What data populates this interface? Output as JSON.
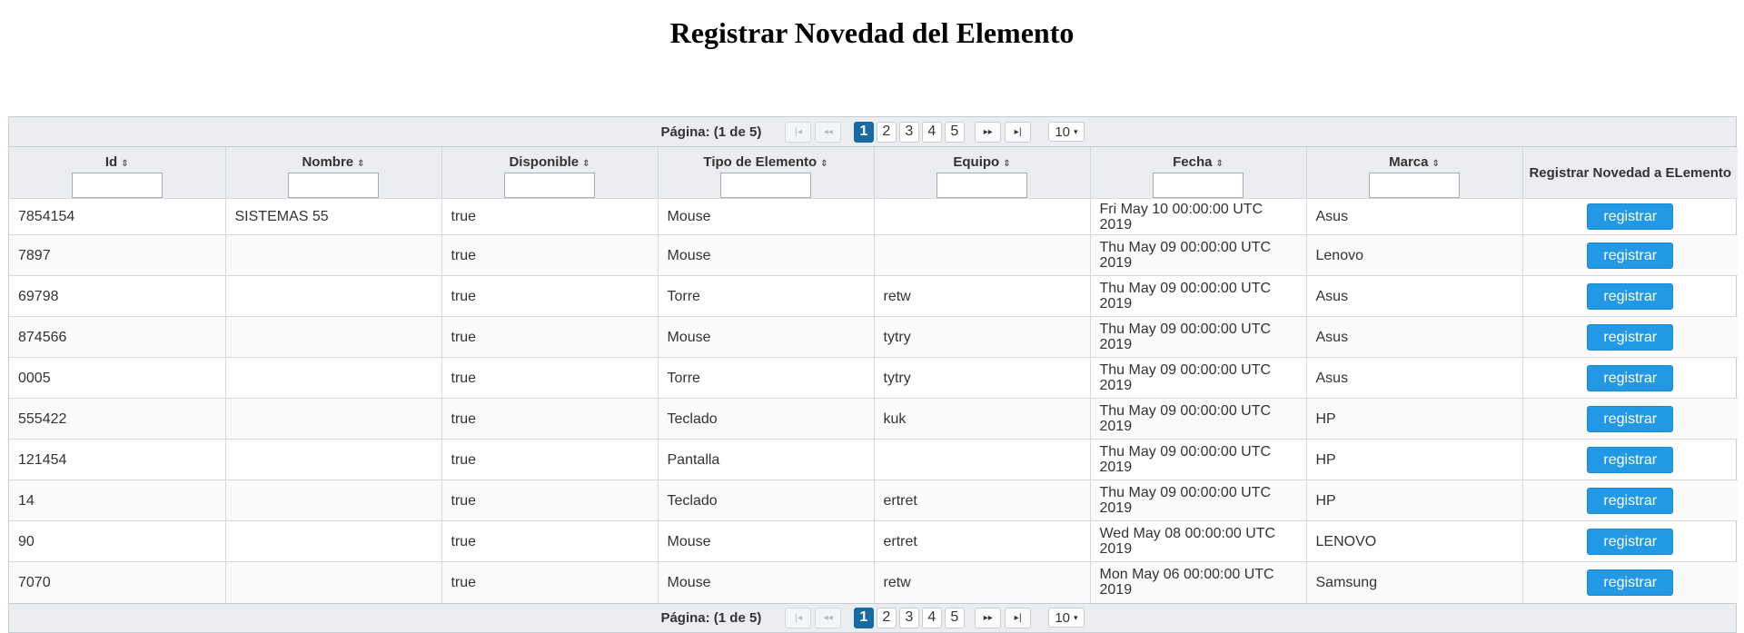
{
  "page": {
    "title": "Registrar Novedad del Elemento"
  },
  "paginator": {
    "current_label": "Página: (1 de 5)",
    "first_icon": "first-page-icon",
    "prev_icon": "prev-page-icon",
    "next_icon": "next-page-icon",
    "last_icon": "last-page-icon",
    "first_glyph": "|◂",
    "prev_glyph": "◂◂",
    "next_glyph": "▸▸",
    "last_glyph": "▸|",
    "pages": [
      "1",
      "2",
      "3",
      "4",
      "5"
    ],
    "active_page": "1",
    "rows_per_page": "10",
    "rows_caret": "▾"
  },
  "table": {
    "sort_glyph": "⇕",
    "columns": [
      {
        "label": "Id",
        "sortable": true,
        "filter": true
      },
      {
        "label": "Nombre",
        "sortable": true,
        "filter": true
      },
      {
        "label": "Disponible",
        "sortable": true,
        "filter": true
      },
      {
        "label": "Tipo de Elemento",
        "sortable": true,
        "filter": true
      },
      {
        "label": "Equipo",
        "sortable": true,
        "filter": true
      },
      {
        "label": "Fecha",
        "sortable": true,
        "filter": true
      },
      {
        "label": "Marca",
        "sortable": true,
        "filter": true
      },
      {
        "label": "Registrar Novedad a ELemento",
        "sortable": false,
        "filter": false
      }
    ],
    "action_label": "registrar",
    "rows": [
      {
        "id": "7854154",
        "nombre": "SISTEMAS 55",
        "disponible": "true",
        "tipo": "Mouse",
        "equipo": "",
        "fecha": "Fri May 10 00:00:00 UTC 2019",
        "marca": "Asus"
      },
      {
        "id": "7897",
        "nombre": "",
        "disponible": "true",
        "tipo": "Mouse",
        "equipo": "",
        "fecha": "Thu May 09 00:00:00 UTC 2019",
        "marca": "Lenovo"
      },
      {
        "id": "69798",
        "nombre": "",
        "disponible": "true",
        "tipo": "Torre",
        "equipo": "retw",
        "fecha": "Thu May 09 00:00:00 UTC 2019",
        "marca": "Asus"
      },
      {
        "id": "874566",
        "nombre": "",
        "disponible": "true",
        "tipo": "Mouse",
        "equipo": "tytry",
        "fecha": "Thu May 09 00:00:00 UTC 2019",
        "marca": "Asus"
      },
      {
        "id": "0005",
        "nombre": "",
        "disponible": "true",
        "tipo": "Torre",
        "equipo": "tytry",
        "fecha": "Thu May 09 00:00:00 UTC 2019",
        "marca": "Asus"
      },
      {
        "id": "555422",
        "nombre": "",
        "disponible": "true",
        "tipo": "Teclado",
        "equipo": "kuk",
        "fecha": "Thu May 09 00:00:00 UTC 2019",
        "marca": "HP"
      },
      {
        "id": "121454",
        "nombre": "",
        "disponible": "true",
        "tipo": "Pantalla",
        "equipo": "",
        "fecha": "Thu May 09 00:00:00 UTC 2019",
        "marca": "HP"
      },
      {
        "id": "14",
        "nombre": "",
        "disponible": "true",
        "tipo": "Teclado",
        "equipo": "ertret",
        "fecha": "Thu May 09 00:00:00 UTC 2019",
        "marca": "HP"
      },
      {
        "id": "90",
        "nombre": "",
        "disponible": "true",
        "tipo": "Mouse",
        "equipo": "ertret",
        "fecha": "Wed May 08 00:00:00 UTC 2019",
        "marca": "LENOVO"
      },
      {
        "id": "7070",
        "nombre": "",
        "disponible": "true",
        "tipo": "Mouse",
        "equipo": "retw",
        "fecha": "Mon May 06 00:00:00 UTC 2019",
        "marca": "Samsung"
      }
    ]
  },
  "colors": {
    "accent": "#2399e5",
    "active_page": "#186ba0",
    "header_bg": "#ebedf0"
  }
}
